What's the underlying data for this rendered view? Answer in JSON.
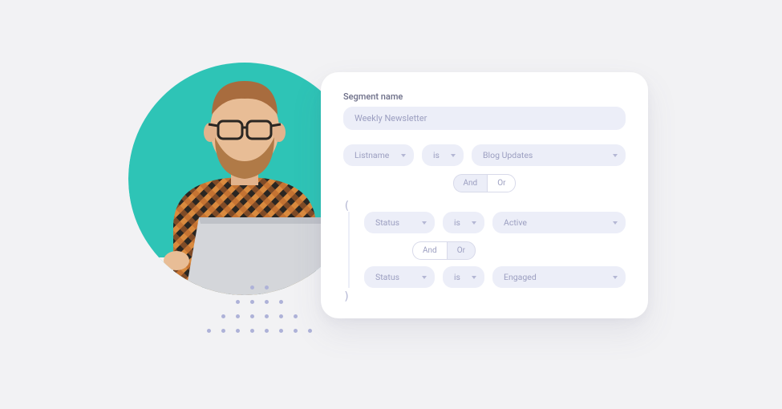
{
  "segment": {
    "label": "Segment name",
    "value": "Weekly Newsletter"
  },
  "rules": {
    "row1": {
      "field": "Listname",
      "op": "is",
      "value": "Blog Updates"
    },
    "logic1": {
      "and": "And",
      "or": "Or",
      "active": "and"
    },
    "group": {
      "open": "(",
      "close": ")",
      "row2": {
        "field": "Status",
        "op": "is",
        "value": "Active"
      },
      "logic2": {
        "and": "And",
        "or": "Or",
        "active": "or"
      },
      "row3": {
        "field": "Status",
        "op": "is",
        "value": "Engaged"
      }
    }
  }
}
